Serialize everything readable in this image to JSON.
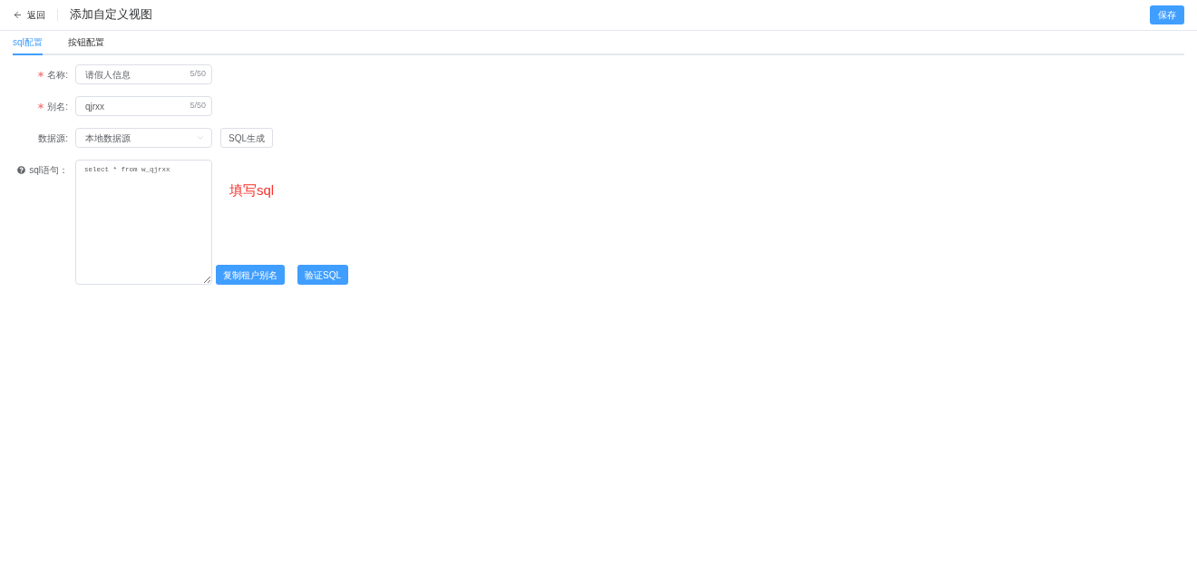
{
  "header": {
    "back": {
      "label": "返回"
    },
    "title": "添加自定义视图",
    "save_button": "保存"
  },
  "tabs": [
    {
      "label": "sql配置",
      "selected": true
    },
    {
      "label": "按钮配置",
      "selected": false
    }
  ],
  "form": {
    "fields": [
      {
        "kind": "text",
        "label": "名称:",
        "required": true,
        "value": "请假人信息",
        "count": "5/50"
      },
      {
        "kind": "text",
        "label": "别名:",
        "required": true,
        "value": "qjrxx",
        "count": "5/50"
      },
      {
        "kind": "select",
        "label": "数据源:",
        "required": false,
        "value": "本地数据源",
        "button": "SQL生成"
      },
      {
        "kind": "textarea",
        "label": "sql语句：",
        "help": true,
        "required": false,
        "value": "select * from w_qjrxx",
        "annotation": "填写sql",
        "buttons": [
          "复制租户别名",
          "验证SQL"
        ]
      }
    ]
  }
}
